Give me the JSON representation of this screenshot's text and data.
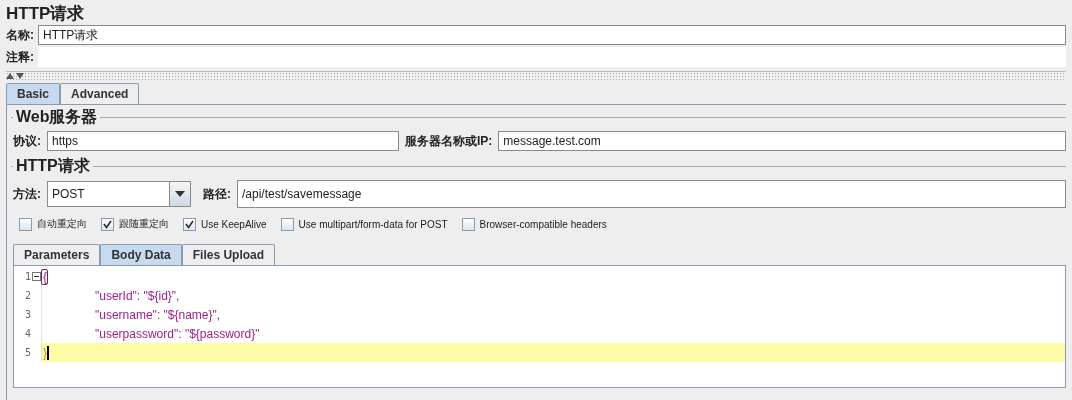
{
  "title": "HTTP请求",
  "name_field": {
    "label": "名称:",
    "value": "HTTP请求"
  },
  "comment_field": {
    "label": "注释:"
  },
  "tabs": [
    {
      "label": "Basic",
      "selected": true
    },
    {
      "label": "Advanced",
      "selected": false
    }
  ],
  "web_server": {
    "title": "Web服务器",
    "protocol": {
      "label": "协议:",
      "value": "https"
    },
    "server": {
      "label": "服务器名称或IP:",
      "value": "message.test.com"
    }
  },
  "http_request": {
    "title": "HTTP请求",
    "method": {
      "label": "方法:",
      "value": "POST"
    },
    "path": {
      "label": "路径:",
      "value": "/api/test/savemessage"
    },
    "options": [
      {
        "label": "自动重定向",
        "checked": false
      },
      {
        "label": "跟随重定向",
        "checked": true
      },
      {
        "label": "Use KeepAlive",
        "checked": true
      },
      {
        "label": "Use multipart/form-data for POST",
        "checked": false
      },
      {
        "label": "Browser-compatible headers",
        "checked": false
      }
    ],
    "subtabs": [
      {
        "label": "Parameters",
        "selected": false
      },
      {
        "label": "Body Data",
        "selected": true
      },
      {
        "label": "Files Upload",
        "selected": false
      }
    ],
    "code_lines": [
      {
        "number": "1",
        "text": "{",
        "foldable": true,
        "highlighted": false,
        "kind": "brace"
      },
      {
        "number": "2",
        "text": "\t\"userId\": \"${id}\",",
        "foldable": false,
        "highlighted": false,
        "kind": "string"
      },
      {
        "number": "3",
        "text": "\t\"username\": \"${name}\",",
        "foldable": false,
        "highlighted": false,
        "kind": "string"
      },
      {
        "number": "4",
        "text": "\t\"userpassword\": \"${password}\"",
        "foldable": false,
        "highlighted": false,
        "kind": "string"
      },
      {
        "number": "5",
        "text": "}",
        "foldable": false,
        "highlighted": true,
        "kind": "caret-brace"
      }
    ]
  }
}
